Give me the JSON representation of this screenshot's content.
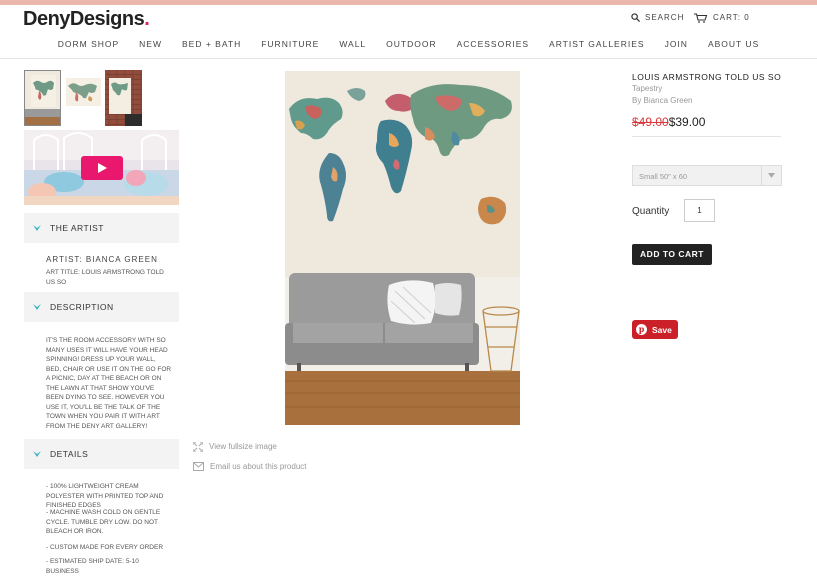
{
  "brand": {
    "name": "DenyDesigns",
    "dot": "."
  },
  "util": {
    "search": "SEARCH",
    "cart": "CART: 0"
  },
  "nav": [
    "DORM SHOP",
    "NEW",
    "BED + BATH",
    "FURNITURE",
    "WALL",
    "OUTDOOR",
    "ACCESSORIES",
    "ARTIST GALLERIES",
    "JOIN",
    "ABOUT US"
  ],
  "sections": {
    "artist": {
      "title": "THE ARTIST",
      "artist_line": "ARTIST: BIANCA GREEN",
      "art_title": "ART TITLE: LOUIS ARMSTRONG TOLD US SO"
    },
    "description": {
      "title": "DESCRIPTION",
      "text": "IT'S THE ROOM ACCESSORY WITH SO MANY USES IT WILL HAVE YOUR HEAD SPINNING! DRESS UP YOUR WALL, BED, CHAIR OR USE IT ON THE GO FOR A PICNIC, DAY AT THE BEACH OR ON THE LAWN AT THAT SHOW YOU'VE BEEN DYING TO SEE. HOWEVER YOU USE IT, YOU'LL BE THE TALK OF THE TOWN WHEN YOU PAIR IT WITH ART FROM THE DENY ART GALLERY!"
    },
    "details": {
      "title": "DETAILS",
      "items": [
        "- 100% LIGHTWEIGHT CREAM POLYESTER WITH PRINTED TOP AND FINISHED EDGES",
        "- MACHINE WASH COLD ON GENTLE CYCLE. TUMBLE DRY LOW. DO NOT BLEACH OR IRON.",
        "- CUSTOM MADE FOR EVERY ORDER",
        "- ESTIMATED SHIP DATE: 5-10 BUSINESS"
      ]
    }
  },
  "links": {
    "fullsize": "View fullsize image",
    "email": "Email us about this product"
  },
  "product": {
    "title": "LOUIS ARMSTRONG TOLD US SO",
    "type": "Tapestry",
    "by": "By Bianca Green",
    "old_price": "$49.00",
    "price": "$39.00",
    "size_selected": "Small 50\" x 60",
    "quantity_label": "Quantity",
    "quantity": "1",
    "add_to_cart": "ADD TO CART",
    "pin_label": "Save"
  },
  "colors": {
    "accent_teal": "#3ab5c4",
    "pinterest": "#cb2027",
    "price_old": "#d9373a",
    "topbar": "#e9b7ac"
  },
  "icons": [
    "search-icon",
    "cart-icon",
    "chevron-down-icon",
    "play-icon",
    "expand-icon",
    "mail-icon",
    "pinterest-icon"
  ]
}
